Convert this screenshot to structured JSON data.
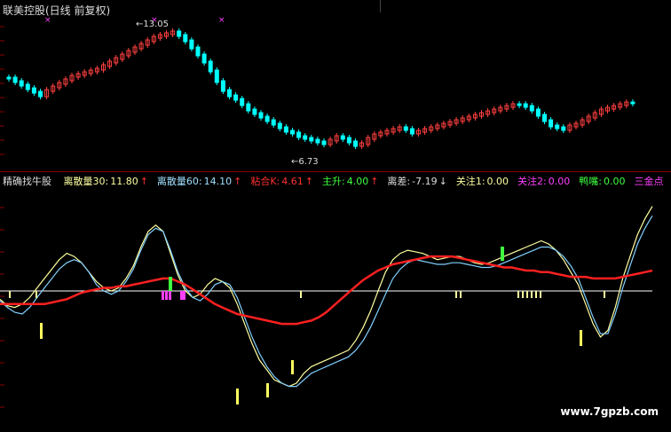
{
  "price_pane": {
    "title": "联美控股(日线 前复权)",
    "high_label": "13.05",
    "low_label": "6.73",
    "colors": {
      "up": "#ff4040",
      "down": "#00ffff",
      "axis": "#8b0000"
    }
  },
  "indicator": {
    "name": "精确找牛股",
    "items": [
      {
        "label": "离散量30:",
        "value": "11.80",
        "arrow": "↑",
        "color": "#ffffa0"
      },
      {
        "label": "离散量60:",
        "value": "14.10",
        "arrow": "↑",
        "color": "#a0e0ff"
      },
      {
        "label": "粘合K:",
        "value": "4.61",
        "arrow": "↑",
        "color": "#ff3030"
      },
      {
        "label": "主升:",
        "value": "4.00",
        "arrow": "↑",
        "color": "#40ff40"
      },
      {
        "label": "离差:",
        "value": "-7.19",
        "arrow": "↓",
        "color": "#dddddd"
      },
      {
        "label": "关注1:",
        "value": "0.00",
        "arrow": "",
        "color": "#ffffa0"
      },
      {
        "label": "关注2:",
        "value": "0.00",
        "arrow": "",
        "color": "#ff40ff"
      },
      {
        "label": "鸭嘴:",
        "value": "0.00",
        "arrow": "",
        "color": "#40ff40"
      },
      {
        "label": "三金点",
        "value": "",
        "arrow": "",
        "color": "#ff40ff"
      }
    ]
  },
  "watermark": "www.7gpzb.com",
  "chart_data": {
    "type": "line",
    "series": [
      {
        "name": "离散量30",
        "color": "#ffffa0",
        "values": [
          -5,
          -9,
          -10,
          -8,
          -4,
          2,
          8,
          14,
          20,
          24,
          22,
          18,
          12,
          6,
          2,
          0,
          2,
          8,
          16,
          28,
          38,
          42,
          38,
          24,
          10,
          0,
          -4,
          -2,
          4,
          8,
          6,
          2,
          -8,
          -20,
          -32,
          -42,
          -48,
          -54,
          -56,
          -58,
          -56,
          -50,
          -46,
          -44,
          -42,
          -40,
          -38,
          -36,
          -30,
          -22,
          -12,
          0,
          12,
          20,
          24,
          26,
          25,
          24,
          22,
          20,
          21,
          22,
          22,
          20,
          18,
          17,
          18,
          20,
          22,
          24,
          26,
          28,
          30,
          32,
          30,
          26,
          20,
          12,
          4,
          -8,
          -20,
          -28,
          -24,
          -10,
          8,
          22,
          36,
          46,
          54
        ]
      },
      {
        "name": "离散量60",
        "color": "#80d0ff",
        "values": [
          -6,
          -10,
          -13,
          -14,
          -10,
          -4,
          2,
          8,
          14,
          18,
          20,
          18,
          12,
          4,
          0,
          -2,
          0,
          6,
          14,
          26,
          36,
          40,
          38,
          26,
          12,
          2,
          -4,
          -6,
          -2,
          4,
          6,
          4,
          -4,
          -16,
          -28,
          -38,
          -46,
          -52,
          -56,
          -58,
          -58,
          -54,
          -50,
          -48,
          -46,
          -44,
          -42,
          -40,
          -36,
          -30,
          -22,
          -12,
          -2,
          8,
          14,
          18,
          20,
          19,
          18,
          17,
          17,
          18,
          18,
          17,
          16,
          15,
          15,
          16,
          18,
          20,
          22,
          24,
          26,
          28,
          28,
          26,
          22,
          16,
          8,
          -4,
          -16,
          -26,
          -26,
          -14,
          2,
          16,
          30,
          40,
          48
        ]
      },
      {
        "name": "粘合K",
        "color": "#ff2020",
        "values": [
          -8,
          -8,
          -8,
          -8,
          -8,
          -8,
          -8,
          -7,
          -6,
          -5,
          -3,
          -1,
          0,
          1,
          2,
          2,
          3,
          3,
          4,
          5,
          6,
          7,
          8,
          8,
          6,
          4,
          1,
          -2,
          -5,
          -8,
          -10,
          -12,
          -14,
          -15,
          -16,
          -17,
          -18,
          -19,
          -20,
          -20,
          -20,
          -19,
          -18,
          -16,
          -13,
          -9,
          -5,
          -1,
          3,
          7,
          10,
          13,
          15,
          17,
          18,
          19,
          20,
          21,
          22,
          22,
          22,
          22,
          21,
          20,
          19,
          18,
          17,
          16,
          15,
          15,
          14,
          13,
          13,
          12,
          12,
          11,
          10,
          9,
          9,
          9,
          8,
          8,
          8,
          8,
          9,
          10,
          11,
          12,
          13
        ]
      }
    ],
    "ylim": [
      -60,
      60
    ]
  }
}
